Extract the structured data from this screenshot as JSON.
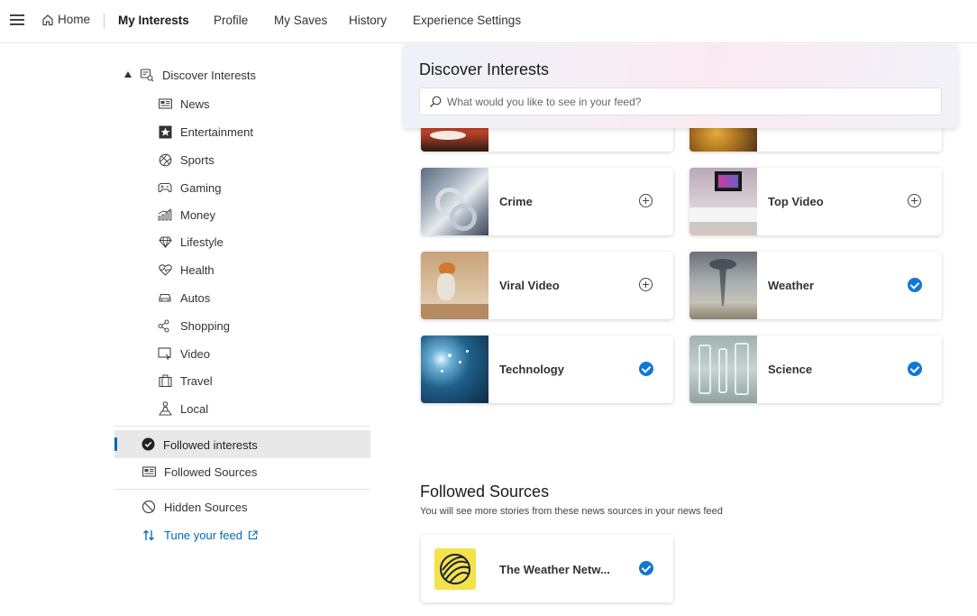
{
  "nav": {
    "home": "Home",
    "links": [
      "My Interests",
      "Profile",
      "My Saves",
      "History",
      "Experience Settings"
    ]
  },
  "sidebar": {
    "discover": "Discover Interests",
    "items": [
      {
        "label": "News",
        "icon": "newspaper-icon"
      },
      {
        "label": "Entertainment",
        "icon": "star-icon"
      },
      {
        "label": "Sports",
        "icon": "ball-icon"
      },
      {
        "label": "Gaming",
        "icon": "gamepad-icon"
      },
      {
        "label": "Money",
        "icon": "chart-icon"
      },
      {
        "label": "Lifestyle",
        "icon": "diamond-icon"
      },
      {
        "label": "Health",
        "icon": "heart-pulse-icon"
      },
      {
        "label": "Autos",
        "icon": "car-icon"
      },
      {
        "label": "Shopping",
        "icon": "shopping-icon"
      },
      {
        "label": "Video",
        "icon": "video-icon"
      },
      {
        "label": "Travel",
        "icon": "luggage-icon"
      },
      {
        "label": "Local",
        "icon": "person-pin-icon"
      }
    ],
    "followed_interests": "Followed interests",
    "followed_sources": "Followed Sources",
    "hidden_sources": "Hidden Sources",
    "tune_feed": "Tune your feed"
  },
  "discover_panel": {
    "title": "Discover Interests",
    "search_placeholder": "What would you like to see in your feed?"
  },
  "cards": [
    {
      "label": "Crime",
      "followed": false
    },
    {
      "label": "Top Video",
      "followed": false
    },
    {
      "label": "Viral Video",
      "followed": false
    },
    {
      "label": "Weather",
      "followed": true
    },
    {
      "label": "Technology",
      "followed": true
    },
    {
      "label": "Science",
      "followed": true
    }
  ],
  "followed_sources": {
    "title": "Followed Sources",
    "subtitle": "You will see more stories from these news sources in your news feed",
    "items": [
      {
        "label": "The Weather Netw...",
        "followed": true
      }
    ]
  },
  "colors": {
    "accent": "#0f78d4",
    "link": "#0067b8",
    "selected_bg": "#e8e8e8"
  }
}
